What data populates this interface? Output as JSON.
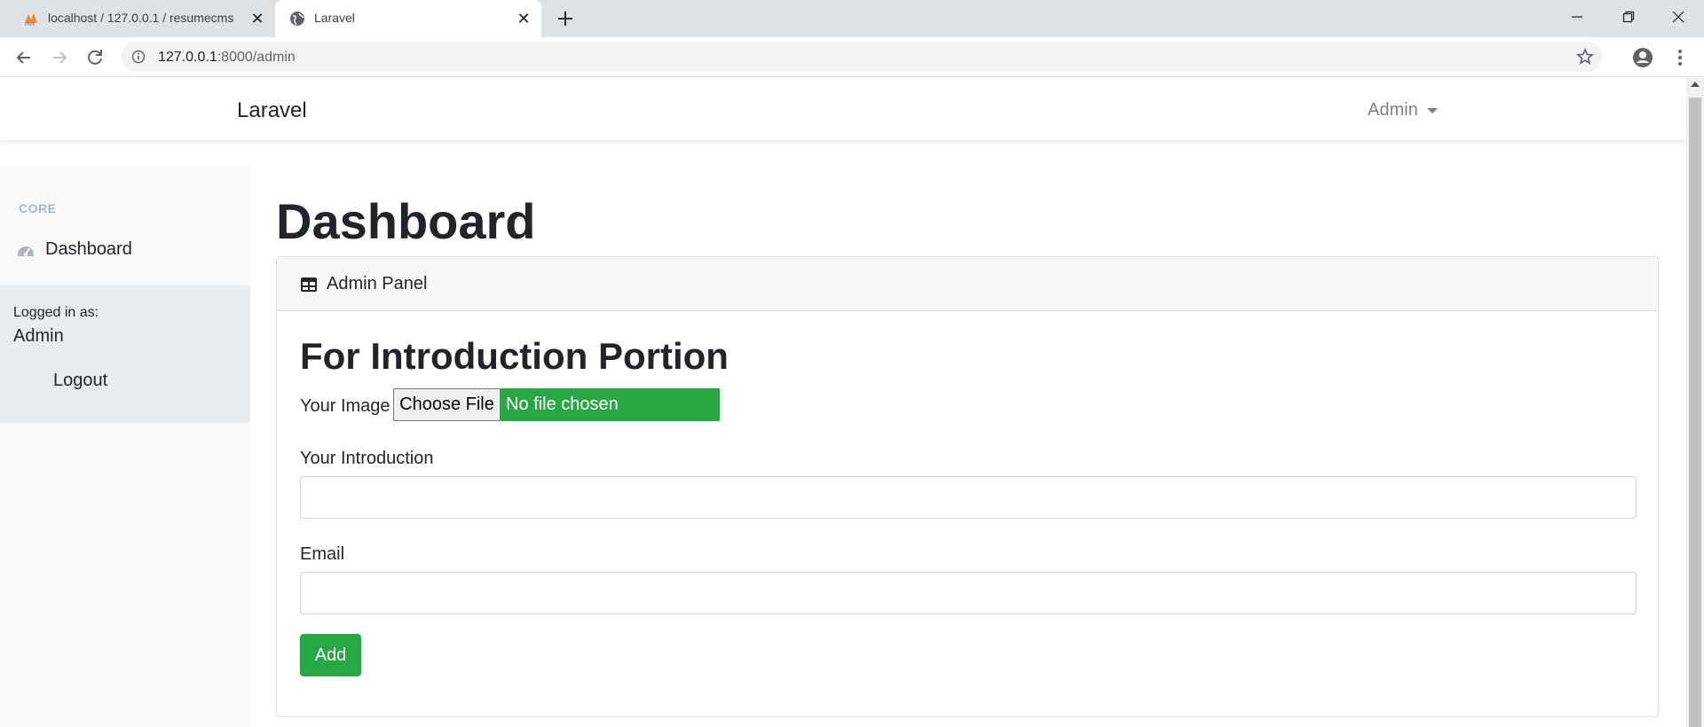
{
  "browser": {
    "tabs": [
      {
        "title": "localhost / 127.0.0.1 / resumecms",
        "icon": "phpmyadmin-icon",
        "active": false
      },
      {
        "title": "Laravel",
        "icon": "globe-icon",
        "active": true
      }
    ],
    "url_host": "127.0.0.1",
    "url_rest": ":8000/admin"
  },
  "navbar": {
    "brand": "Laravel",
    "user_menu": "Admin"
  },
  "sidebar": {
    "heading": "CORE",
    "items": [
      {
        "label": "Dashboard",
        "icon": "tachometer-icon"
      }
    ],
    "footer": {
      "logged_in_label": "Logged in as:",
      "user": "Admin",
      "logout": "Logout"
    }
  },
  "main": {
    "title": "Dashboard",
    "card": {
      "header": "Admin Panel",
      "header_icon": "table-icon",
      "section_title": "For Introduction Portion",
      "image_label": "Your Image",
      "file_button": "Choose File",
      "file_status": "No file chosen",
      "intro_label": "Your Introduction",
      "intro_value": "",
      "email_label": "Email",
      "email_value": "",
      "submit": "Add"
    }
  },
  "colors": {
    "success": "#28a745",
    "sidebar_bg": "#f8f9fa",
    "sidebar_footer_bg": "#e9ecef",
    "muted": "#808080"
  }
}
